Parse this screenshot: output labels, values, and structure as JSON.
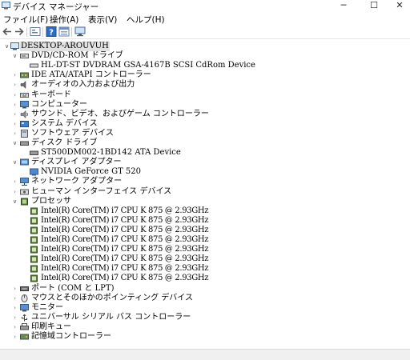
{
  "window": {
    "title": "デバイス マネージャー",
    "minimize_glyph": "─",
    "maximize_glyph": "☐",
    "close_glyph": "✕"
  },
  "menu": [
    "ファイル(F)",
    "操作(A)",
    "表示(V)",
    "ヘルプ(H)"
  ],
  "toolbar_icons": [
    "back-icon",
    "forward-icon",
    "device-view-icon",
    "help-icon",
    "properties-icon",
    "monitor-scan-icon"
  ],
  "tree": {
    "root": "DESKTOP-AROUVUH",
    "categories": [
      {
        "label": "DVD/CD-ROM ドライブ",
        "expanded": true,
        "icon": "dvd-drive-icon",
        "children": [
          "HL-DT-ST DVDRAM GSA-4167B SCSI CdRom Device"
        ]
      },
      {
        "label": "IDE ATA/ATAPI コントローラー",
        "expanded": false,
        "icon": "ide-controller-icon"
      },
      {
        "label": "オーディオの入力および出力",
        "expanded": false,
        "icon": "speaker-icon"
      },
      {
        "label": "キーボード",
        "expanded": false,
        "icon": "keyboard-icon"
      },
      {
        "label": "コンピューター",
        "expanded": false,
        "icon": "computer-icon"
      },
      {
        "label": "サウンド、ビデオ、およびゲーム コントローラー",
        "expanded": false,
        "icon": "sound-icon"
      },
      {
        "label": "システム デバイス",
        "expanded": false,
        "icon": "system-device-icon"
      },
      {
        "label": "ソフトウェア デバイス",
        "expanded": false,
        "icon": "software-device-icon"
      },
      {
        "label": "ディスク ドライブ",
        "expanded": true,
        "icon": "disk-drive-icon",
        "children": [
          "ST500DM002-1BD142 ATA Device"
        ]
      },
      {
        "label": "ディスプレイ アダプター",
        "expanded": true,
        "icon": "display-adapter-icon",
        "children": [
          "NVIDIA GeForce GT 520"
        ]
      },
      {
        "label": "ネットワーク アダプター",
        "expanded": false,
        "icon": "network-adapter-icon"
      },
      {
        "label": "ヒューマン インターフェイス デバイス",
        "expanded": false,
        "icon": "hid-icon"
      },
      {
        "label": "プロセッサ",
        "expanded": true,
        "icon": "processor-icon",
        "children": [
          "Intel(R) Core(TM) i7 CPU      K 875  @ 2.93GHz",
          "Intel(R) Core(TM) i7 CPU      K 875  @ 2.93GHz",
          "Intel(R) Core(TM) i7 CPU      K 875  @ 2.93GHz",
          "Intel(R) Core(TM) i7 CPU      K 875  @ 2.93GHz",
          "Intel(R) Core(TM) i7 CPU      K 875  @ 2.93GHz",
          "Intel(R) Core(TM) i7 CPU      K 875  @ 2.93GHz",
          "Intel(R) Core(TM) i7 CPU      K 875  @ 2.93GHz",
          "Intel(R) Core(TM) i7 CPU      K 875  @ 2.93GHz"
        ]
      },
      {
        "label": "ポート (COM と LPT)",
        "expanded": false,
        "icon": "port-icon"
      },
      {
        "label": "マウスとそのほかのポインティング デバイス",
        "expanded": false,
        "icon": "mouse-icon"
      },
      {
        "label": "モニター",
        "expanded": false,
        "icon": "monitor-icon"
      },
      {
        "label": "ユニバーサル シリアル バス コントローラー",
        "expanded": false,
        "icon": "usb-icon"
      },
      {
        "label": "印刷キュー",
        "expanded": false,
        "icon": "printer-icon"
      },
      {
        "label": "記憶域コントローラー",
        "expanded": false,
        "icon": "storage-controller-icon"
      }
    ]
  }
}
